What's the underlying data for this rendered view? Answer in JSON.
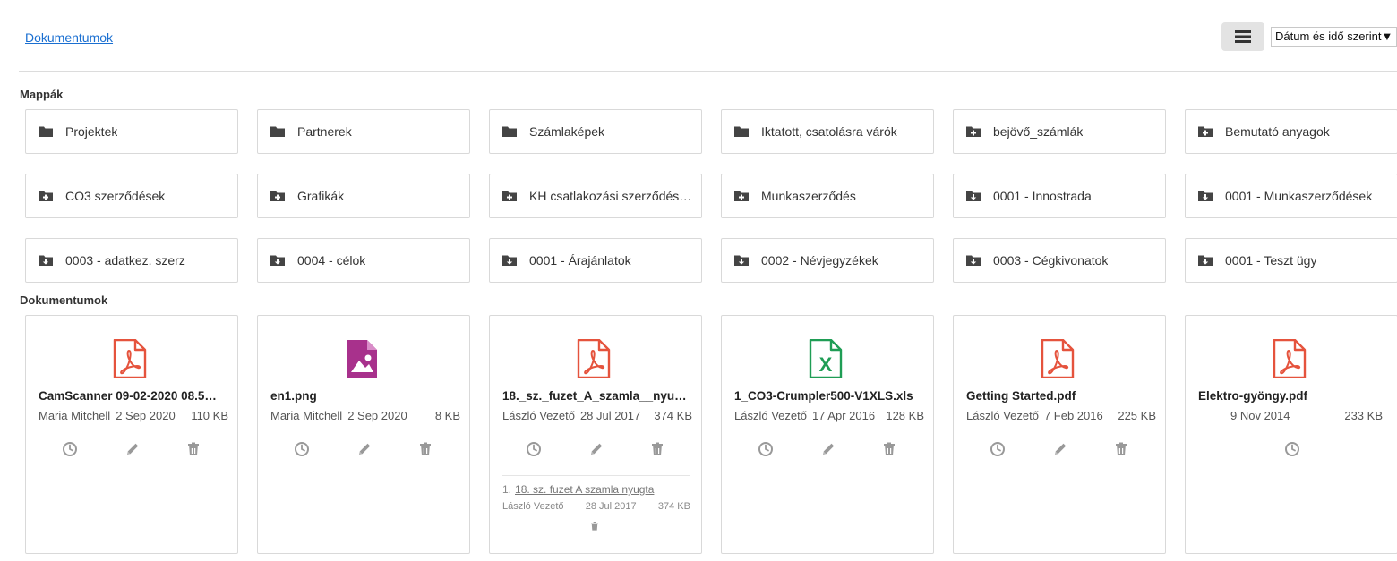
{
  "header": {
    "breadcrumb": "Dokumentumok",
    "sort_label": "Dátum és idő szerint▼",
    "view_icon": "list-icon"
  },
  "folders_section": {
    "title": "Mappák",
    "items": [
      {
        "name": "Projektek",
        "icon": "folder-icon"
      },
      {
        "name": "Partnerek",
        "icon": "folder-icon"
      },
      {
        "name": "Számlaképek",
        "icon": "folder-icon"
      },
      {
        "name": "Iktatott, csatolásra várók",
        "icon": "folder-icon"
      },
      {
        "name": "bejövő_számlák",
        "icon": "folder-plus-icon"
      },
      {
        "name": "Bemutató anyagok",
        "icon": "folder-plus-icon"
      },
      {
        "name": "CO3 szerződések",
        "icon": "folder-plus-icon"
      },
      {
        "name": "Grafikák",
        "icon": "folder-plus-icon"
      },
      {
        "name": "KH csatlakozási szerződés…",
        "icon": "folder-plus-icon"
      },
      {
        "name": "Munkaszerződés",
        "icon": "folder-plus-icon"
      },
      {
        "name": "0001 - Innostrada",
        "icon": "folder-download-icon"
      },
      {
        "name": "0001 - Munkaszerződések",
        "icon": "folder-download-icon"
      },
      {
        "name": "0003 - adatkez. szerz",
        "icon": "folder-download-icon"
      },
      {
        "name": "0004 - célok",
        "icon": "folder-download-icon"
      },
      {
        "name": "0001 - Árajánlatok",
        "icon": "folder-download-icon"
      },
      {
        "name": "0002 - Névjegyzékek",
        "icon": "folder-download-icon"
      },
      {
        "name": "0003 - Cégkivonatok",
        "icon": "folder-download-icon"
      },
      {
        "name": "0001 - Teszt ügy",
        "icon": "folder-download-icon"
      }
    ]
  },
  "documents_section": {
    "title": "Dokumentumok",
    "items": [
      {
        "name": "CamScanner 09-02-2020 08.5…",
        "owner": "Maria Mitchell",
        "date": "2 Sep 2020",
        "size": "110 KB",
        "icon": "pdf-file-icon",
        "color": "#e5533d"
      },
      {
        "name": "en1.png",
        "owner": "Maria Mitchell",
        "date": "2 Sep 2020",
        "size": "8 KB",
        "icon": "image-file-icon",
        "color": "#a8318c"
      },
      {
        "name": "18._sz._fuzet_A_szamla__nyug…",
        "owner": "László Vezető",
        "date": "28 Jul 2017",
        "size": "374 KB",
        "icon": "pdf-file-icon",
        "color": "#e5533d",
        "version": {
          "index": "1.",
          "name": "18. sz. fuzet A szamla  nyugta",
          "owner": "László Vezető",
          "date": "28 Jul 2017",
          "size": "374 KB"
        }
      },
      {
        "name": "1_CO3-Crumpler500-V1XLS.xls",
        "owner": "László Vezető",
        "date": "17 Apr 2016",
        "size": "128 KB",
        "icon": "excel-file-icon",
        "color": "#1f9d55"
      },
      {
        "name": "Getting Started.pdf",
        "owner": "László Vezető",
        "date": "7 Feb 2016",
        "size": "225 KB",
        "icon": "pdf-file-icon",
        "color": "#e5533d"
      },
      {
        "name": "Elektro-gyöngy.pdf",
        "owner": "",
        "date": "9 Nov 2014",
        "size": "233 KB",
        "icon": "pdf-file-icon",
        "color": "#e5533d"
      }
    ]
  }
}
